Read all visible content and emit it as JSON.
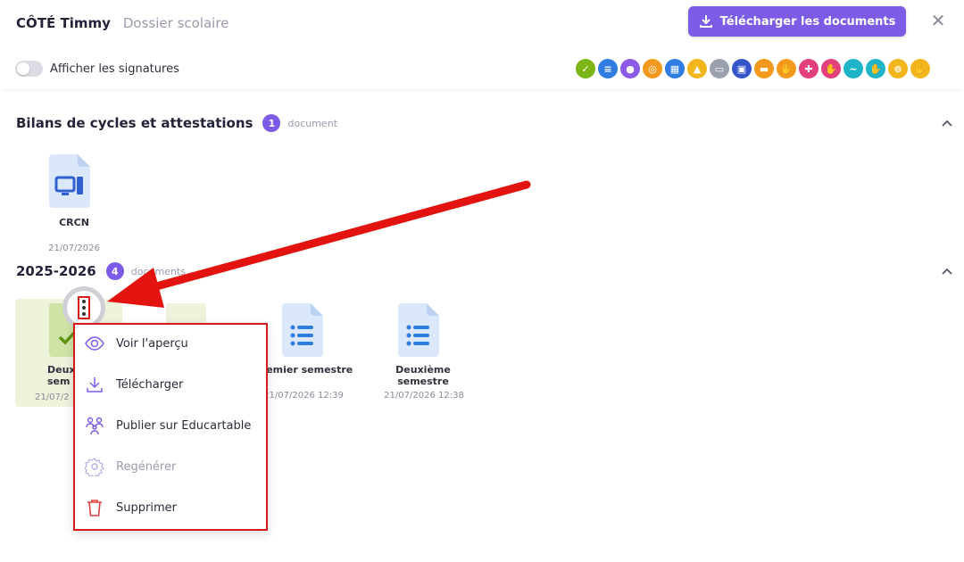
{
  "header": {
    "student": "CÔTÉ Timmy",
    "subtitle": "Dossier scolaire",
    "download_label": "Télécharger les documents"
  },
  "toolbar": {
    "toggle_label": "Afficher les signatures"
  },
  "categories": [
    {
      "icon": "check-icon",
      "color": "#7cb518"
    },
    {
      "icon": "list-icon",
      "color": "#2f7de1"
    },
    {
      "icon": "paw-icon",
      "color": "#8b5be6"
    },
    {
      "icon": "medal-icon",
      "color": "#f39a1e"
    },
    {
      "icon": "grid-icon",
      "color": "#2f7de1"
    },
    {
      "icon": "bank-icon",
      "color": "#f2b61c"
    },
    {
      "icon": "screen-icon",
      "color": "#9aa0ad"
    },
    {
      "icon": "computer-icon",
      "color": "#3555c9"
    },
    {
      "icon": "car-icon",
      "color": "#f39a1e"
    },
    {
      "icon": "hand-icon",
      "color": "#f39a1e"
    },
    {
      "icon": "medical-icon",
      "color": "#e43f7d"
    },
    {
      "icon": "hand-icon",
      "color": "#e43f7d"
    },
    {
      "icon": "swim-icon",
      "color": "#20b4c8"
    },
    {
      "icon": "hand-icon",
      "color": "#20b4c8"
    },
    {
      "icon": "bike-icon",
      "color": "#f2b61c"
    },
    {
      "icon": "hand-icon",
      "color": "#f2b61c"
    }
  ],
  "sections": {
    "bilans": {
      "title": "Bilans de cycles et attestations",
      "count": "1",
      "count_label": "document",
      "doc": {
        "name": "CRCN",
        "date": "21/07/2026"
      }
    },
    "year": {
      "title": "2025-2026",
      "count": "4",
      "count_label": "documents",
      "doc1": {
        "name_a": "Deux",
        "name_b": "sem",
        "date": "21/07/2"
      },
      "doc3": {
        "name": "Premier semestre",
        "date": "21/07/2026 12:39"
      },
      "doc4": {
        "name_a": "Deuxième",
        "name_b": "semestre",
        "date": "21/07/2026 12:38"
      }
    }
  },
  "menu": [
    {
      "icon": "eye-icon",
      "label": "Voir l'aperçu"
    },
    {
      "icon": "download-icon",
      "label": "Télécharger"
    },
    {
      "icon": "people-icon",
      "label": "Publier sur Educartable"
    },
    {
      "icon": "gear-icon",
      "label": "Regénérer",
      "disabled": true
    },
    {
      "icon": "trash-icon",
      "label": "Supprimer"
    }
  ]
}
